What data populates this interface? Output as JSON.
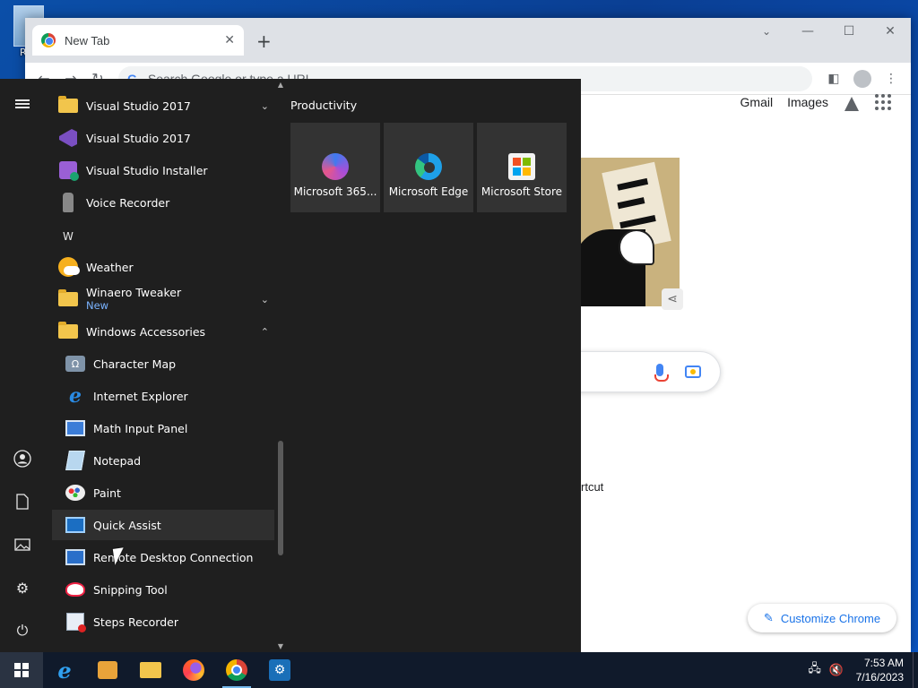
{
  "desktop": {
    "recycle_bin_label": "Rec"
  },
  "browser": {
    "tab_title": "New Tab",
    "tab_close": "✕",
    "new_tab": "+",
    "window_controls": {
      "dropdown": "⌄",
      "minimize": "—",
      "maximize": "☐",
      "close": "✕"
    },
    "omnibox_placeholder": "Search Google or type a URL",
    "ntp": {
      "gmail": "Gmail",
      "images": "Images",
      "shortcut_text_fragment": "rtcut",
      "customize_label": "Customize Chrome"
    }
  },
  "start_menu": {
    "app_list": [
      {
        "label": "Visual Studio 2017",
        "icon": "folder-icon",
        "chevron": "⌄"
      },
      {
        "label": "Visual Studio 2017",
        "icon": "visual-studio-icon"
      },
      {
        "label": "Visual Studio Installer",
        "icon": "vs-installer-icon"
      },
      {
        "label": "Voice Recorder",
        "icon": "voice-recorder-icon"
      },
      {
        "label": "Weather",
        "icon": "weather-icon"
      },
      {
        "label": "Winaero Tweaker",
        "sublabel": "New",
        "icon": "folder-icon",
        "chevron": "⌄"
      },
      {
        "label": "Windows Accessories",
        "icon": "folder-icon",
        "chevron": "⌃"
      },
      {
        "label": "Character Map",
        "icon": "character-map-icon"
      },
      {
        "label": "Internet Explorer",
        "icon": "internet-explorer-icon"
      },
      {
        "label": "Math Input Panel",
        "icon": "math-input-icon"
      },
      {
        "label": "Notepad",
        "icon": "notepad-icon"
      },
      {
        "label": "Paint",
        "icon": "paint-icon"
      },
      {
        "label": "Quick Assist",
        "icon": "quick-assist-icon"
      },
      {
        "label": "Remote Desktop Connection",
        "icon": "remote-desktop-icon"
      },
      {
        "label": "Snipping Tool",
        "icon": "snipping-tool-icon"
      },
      {
        "label": "Steps Recorder",
        "icon": "steps-recorder-icon"
      }
    ],
    "section_letter_w": "W",
    "tile_group": "Productivity",
    "tiles": [
      {
        "label": "Microsoft 365...",
        "icon": "microsoft-365-icon"
      },
      {
        "label": "Microsoft Edge",
        "icon": "microsoft-edge-icon"
      },
      {
        "label": "Microsoft Store",
        "icon": "microsoft-store-icon"
      }
    ],
    "store_colors": [
      "#f25022",
      "#7fba00",
      "#00a4ef",
      "#ffb900"
    ]
  },
  "taskbar": {
    "time": "7:53 AM",
    "date": "7/16/2023"
  }
}
